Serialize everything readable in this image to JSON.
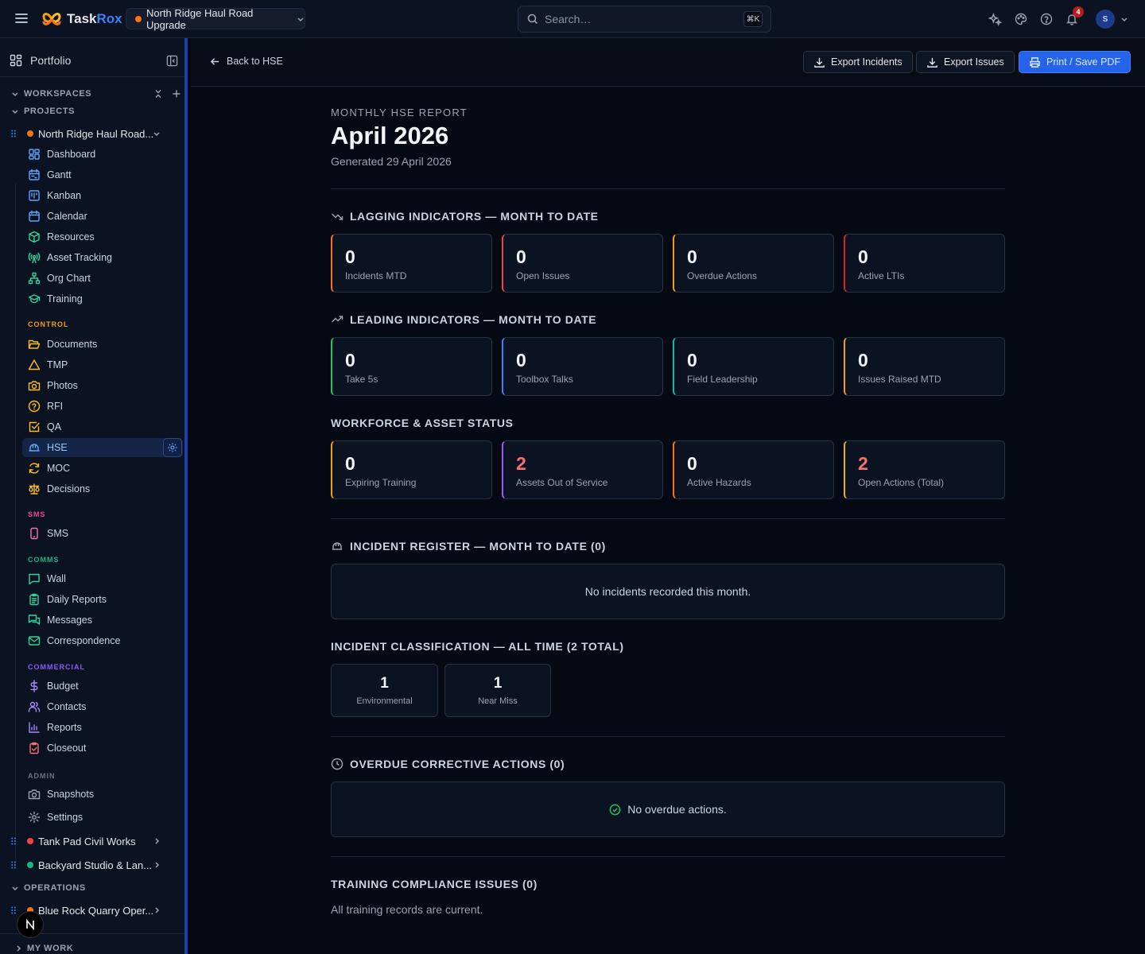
{
  "app": {
    "brand_task": "Task",
    "brand_rox": "Rox"
  },
  "topbar": {
    "project": "North Ridge Haul Road Upgrade",
    "search_placeholder": "Search…",
    "shortcut": "⌘K",
    "notifications": "4",
    "avatar_initial": "S",
    "icons": [
      "menu-icon",
      "sparkles-icon",
      "palette-icon",
      "help-icon",
      "bell-icon",
      "chevron-down-icon"
    ]
  },
  "sidebar": {
    "portfolio": "Portfolio",
    "workspaces": "WORKSPACES",
    "projects_label": "PROJECTS",
    "active_project": "North Ridge Haul Road...",
    "nav_main": [
      {
        "label": "Dashboard",
        "icon": "layout-dashboard-icon",
        "color": "#60a5fa"
      },
      {
        "label": "Gantt",
        "icon": "calendar-range-icon",
        "color": "#60a5fa"
      },
      {
        "label": "Kanban",
        "icon": "kanban-icon",
        "color": "#60a5fa"
      },
      {
        "label": "Calendar",
        "icon": "calendar-icon",
        "color": "#60a5fa"
      },
      {
        "label": "Resources",
        "icon": "box-icon",
        "color": "#34d399"
      },
      {
        "label": "Asset Tracking",
        "icon": "radio-tower-icon",
        "color": "#34d399"
      },
      {
        "label": "Org Chart",
        "icon": "network-icon",
        "color": "#34d399"
      },
      {
        "label": "Training",
        "icon": "graduation-cap-icon",
        "color": "#34d399"
      }
    ],
    "control_label": "CONTROL",
    "nav_control": [
      {
        "label": "Documents",
        "icon": "folder-open-icon",
        "color": "#fbbf24"
      },
      {
        "label": "TMP",
        "icon": "triangle-icon",
        "color": "#fbbf24"
      },
      {
        "label": "Photos",
        "icon": "camera-icon",
        "color": "#fbbf24"
      },
      {
        "label": "RFI",
        "icon": "help-circle-icon",
        "color": "#fbbf24"
      },
      {
        "label": "QA",
        "icon": "check-square-icon",
        "color": "#fbbf24"
      },
      {
        "label": "HSE",
        "icon": "hard-hat-icon",
        "color": "#60a5fa"
      },
      {
        "label": "MOC",
        "icon": "refresh-icon",
        "color": "#fbbf24"
      },
      {
        "label": "Decisions",
        "icon": "scale-icon",
        "color": "#fbbf24"
      }
    ],
    "sms_label": "SMS",
    "nav_sms": [
      {
        "label": "SMS",
        "icon": "smartphone-icon",
        "color": "#f472b6"
      }
    ],
    "comms_label": "COMMS",
    "nav_comms": [
      {
        "label": "Wall",
        "icon": "message-square-icon",
        "color": "#34d399"
      },
      {
        "label": "Daily Reports",
        "icon": "clipboard-list-icon",
        "color": "#34d399"
      },
      {
        "label": "Messages",
        "icon": "messages-icon",
        "color": "#34d399"
      },
      {
        "label": "Correspondence",
        "icon": "mail-icon",
        "color": "#34d399"
      }
    ],
    "commercial_label": "COMMERCIAL",
    "nav_commercial": [
      {
        "label": "Budget",
        "icon": "dollar-icon",
        "color": "#a78bfa"
      },
      {
        "label": "Contacts",
        "icon": "users-icon",
        "color": "#a78bfa"
      },
      {
        "label": "Reports",
        "icon": "bar-chart-icon",
        "color": "#a78bfa"
      },
      {
        "label": "Closeout",
        "icon": "clipboard-check-icon",
        "color": "#f87171"
      }
    ],
    "admin_label": "ADMIN",
    "nav_admin": [
      {
        "label": "Snapshots",
        "icon": "camera-icon",
        "color": "#9ca3af"
      },
      {
        "label": "Settings",
        "icon": "gear-icon",
        "color": "#9ca3af"
      }
    ],
    "other_projects": [
      {
        "label": "Tank Pad Civil Works",
        "color": "#ef4444"
      },
      {
        "label": "Backyard Studio & Lan...",
        "color": "#10b981"
      }
    ],
    "operations_label": "OPERATIONS",
    "operations_project": "Blue Rock Quarry Oper...",
    "my_work_label": "MY WORK"
  },
  "main": {
    "back": "Back to HSE",
    "export_incidents": "Export Incidents",
    "export_issues": "Export Issues",
    "print": "Print / Save PDF",
    "eyebrow": "MONTHLY HSE REPORT",
    "title": "April 2026",
    "generated": "Generated 29 April 2026",
    "lagging_title": "LAGGING INDICATORS — MONTH TO DATE",
    "lagging": [
      {
        "value": "0",
        "label": "Incidents MTD",
        "accent": "#f97316"
      },
      {
        "value": "0",
        "label": "Open Issues",
        "accent": "#ef4444"
      },
      {
        "value": "0",
        "label": "Overdue Actions",
        "accent": "#f59e0b"
      },
      {
        "value": "0",
        "label": "Active LTIs",
        "accent": "#dc2626"
      }
    ],
    "leading_title": "LEADING INDICATORS — MONTH TO DATE",
    "leading": [
      {
        "value": "0",
        "label": "Take 5s",
        "accent": "#22c55e"
      },
      {
        "value": "0",
        "label": "Toolbox Talks",
        "accent": "#3b82f6"
      },
      {
        "value": "0",
        "label": "Field Leadership",
        "accent": "#14b8a6"
      },
      {
        "value": "0",
        "label": "Issues Raised MTD",
        "accent": "#f59e0b"
      }
    ],
    "workforce_title": "WORKFORCE & ASSET STATUS",
    "workforce": [
      {
        "value": "0",
        "label": "Expiring Training",
        "accent": "#f59e0b"
      },
      {
        "value": "2",
        "label": "Assets Out of Service",
        "accent": "#a855f7",
        "highlight": true
      },
      {
        "value": "0",
        "label": "Active Hazards",
        "accent": "#f97316"
      },
      {
        "value": "2",
        "label": "Open Actions (Total)",
        "accent": "#eab308",
        "highlight": true
      }
    ],
    "incident_register_title": "INCIDENT REGISTER — MONTH TO DATE (0)",
    "incident_register_empty": "No incidents recorded this month.",
    "classification_title": "INCIDENT CLASSIFICATION — ALL TIME (2 TOTAL)",
    "classification": [
      {
        "value": "1",
        "label": "Environmental"
      },
      {
        "value": "1",
        "label": "Near Miss"
      }
    ],
    "overdue_title": "OVERDUE CORRECTIVE ACTIONS (0)",
    "overdue_empty": "No overdue actions.",
    "training_title": "TRAINING COMPLIANCE ISSUES (0)",
    "training_text": "All training records are current."
  }
}
